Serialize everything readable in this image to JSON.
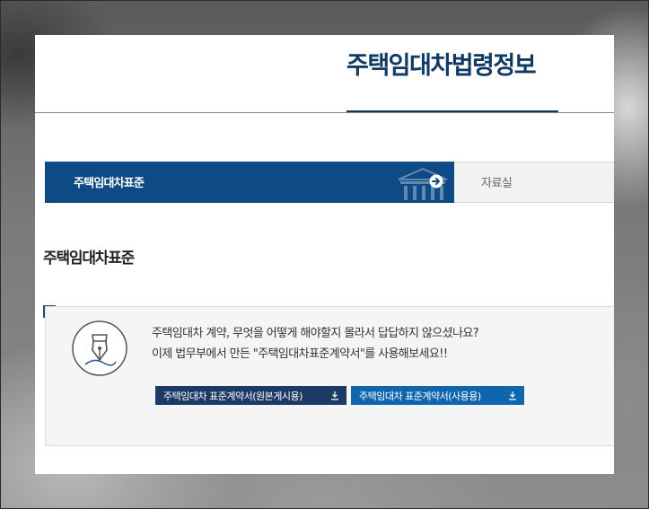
{
  "header": {
    "site_title": "주택임대차법령정보"
  },
  "tabs": [
    {
      "label": "주택임대차표준",
      "active": true
    },
    {
      "label": "자료실",
      "active": false
    }
  ],
  "section": {
    "heading": "주택임대차표준"
  },
  "info": {
    "line1": "주택임대차 계약, 무엇을 어떻게 해야할지 몰라서 답답하지 않으셨나요?",
    "line2": "이제 법무부에서 만든 \"주택임대차표준계약서\"를 사용해보세요!!",
    "buttons": [
      {
        "label": "주택임대차 표준계약서(원본게시용)",
        "icon": "download-icon"
      },
      {
        "label": "주택임대차 표준계약서(사용용)",
        "icon": "download-icon"
      }
    ]
  },
  "colors": {
    "brand_navy": "#103a63",
    "tab_active": "#0e4a86",
    "button_dark": "#1c3a66",
    "button_blue": "#0f66ad"
  }
}
